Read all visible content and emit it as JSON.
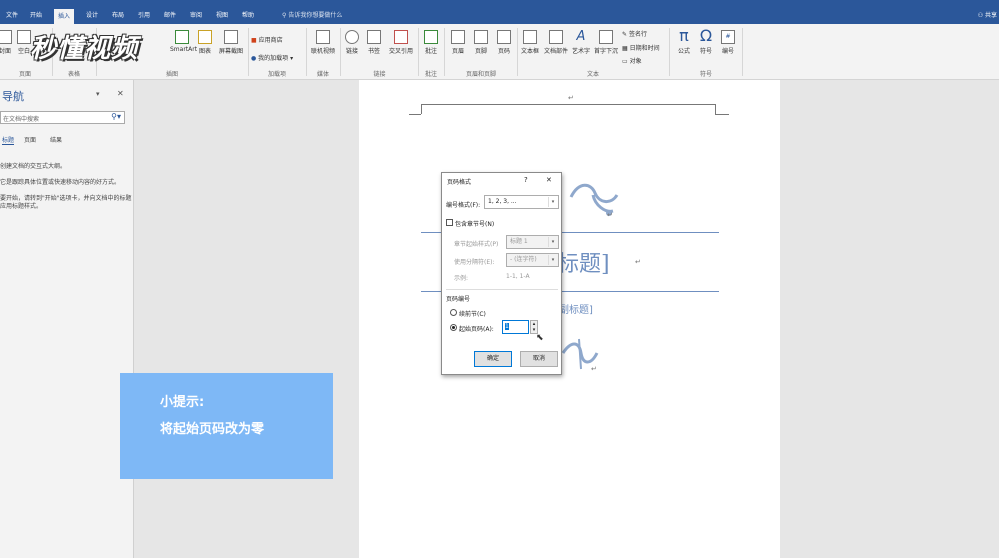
{
  "tabs": [
    "文件",
    "开始",
    "插入",
    "设计",
    "布局",
    "引用",
    "邮件",
    "审阅",
    "视图",
    "帮助"
  ],
  "active_tab": "插入",
  "tell_me": "告诉我你想要做什么",
  "share": "共享",
  "ribbon": {
    "left_buttons": [
      "封面",
      "空白"
    ],
    "smartart": "SmartArt",
    "chart": "图表",
    "screenshot": "屏幕截图",
    "store": "应用商店",
    "myaddins": "我的加载项",
    "online_video": "联机视频",
    "link": "链接",
    "bookmark": "书签",
    "crossref": "交叉引用",
    "comment": "批注",
    "header": "页眉",
    "footer": "页脚",
    "pagenum": "页码",
    "textbox": "文本框",
    "quickparts": "文档部件",
    "wordart": "艺术字",
    "dropcap": "首字下沉",
    "signature": "签名行",
    "datetime": "日期和时间",
    "object": "对象",
    "equation": "公式",
    "symbol": "符号",
    "number": "编号",
    "groups": {
      "pages": "页面",
      "tables": "表格",
      "illustrations": "插图",
      "addins": "加载项",
      "media": "媒体",
      "links": "链接",
      "comments": "批注",
      "headerfooter": "页眉和页脚",
      "text": "文本",
      "symbols": "符号"
    }
  },
  "watermark": "秒懂视频",
  "nav": {
    "title": "导航",
    "search_placeholder": "在文档中搜索",
    "tabs": [
      "标题",
      "页面",
      "结果"
    ],
    "lines": [
      "创建文档的交互式大纲。",
      "它是跟踪具体位置或快速移动内容的好方式。",
      "要开始，请转到\"开始\"选项卡，并向文档中的标题应用标题样式。"
    ]
  },
  "doc": {
    "title_fragment": "标题]",
    "subtitle_fragment": "副标题]"
  },
  "dialog": {
    "title": "页码格式",
    "help": "?",
    "close": "✕",
    "format_label": "编号格式(F):",
    "format_value": "1, 2, 3, ...",
    "include_chapter": "包含章节号(N)",
    "chapter_style_label": "章节起始样式(P)",
    "chapter_style_value": "标题 1",
    "separator_label": "使用分隔符(E):",
    "separator_value": "-  (连字符)",
    "example_label": "示例:",
    "example_value": "1-1, 1-A",
    "numbering_label": "页码编号",
    "continue_label": "续前节(C)",
    "start_label": "起始页码(A):",
    "start_value": "1",
    "ok": "确定",
    "cancel": "取消"
  },
  "hint": {
    "title": "小提示:",
    "text": "将起始页码改为零"
  }
}
